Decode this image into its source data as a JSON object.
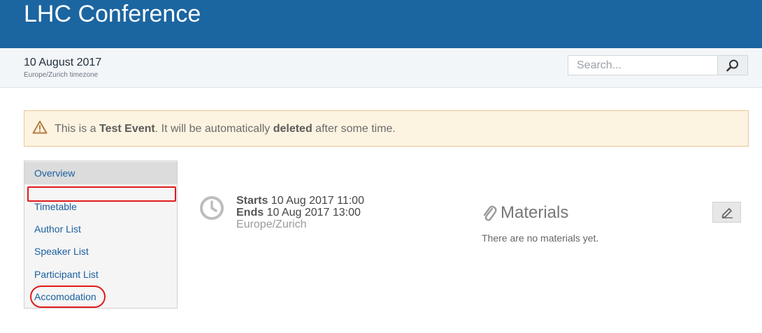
{
  "header": {
    "title": "LHC Conference"
  },
  "event": {
    "date": "10 August 2017",
    "timezone": "Europe/Zurich timezone"
  },
  "search": {
    "placeholder": "Search...",
    "button_icon": "search-icon"
  },
  "alert": {
    "prefix": "This is a ",
    "strong1": "Test Event",
    "middle": ". It will be automatically ",
    "strong2": "deleted",
    "suffix": " after some time.",
    "icon": "warning-icon"
  },
  "menu": {
    "items": [
      {
        "label": "Overview",
        "active": true
      },
      {
        "label": "Timetable"
      },
      {
        "label": "Author List"
      },
      {
        "label": "Speaker List"
      },
      {
        "label": "Participant List"
      },
      {
        "label": "Accomodation"
      }
    ]
  },
  "schedule": {
    "starts_label": "Starts",
    "starts_value": " 10 Aug 2017 11:00",
    "ends_label": "Ends",
    "ends_value": " 10 Aug 2017 13:00",
    "timezone": "Europe/Zurich"
  },
  "materials": {
    "title": "Materials",
    "empty_text": "There are no materials yet.",
    "icon": "paperclip-icon",
    "edit_icon": "pencil-icon"
  },
  "colors": {
    "header": "#1b65a1",
    "link": "#1b5fa0",
    "alert_bg": "#fdf3e1",
    "highlight": "#e11a1a"
  }
}
